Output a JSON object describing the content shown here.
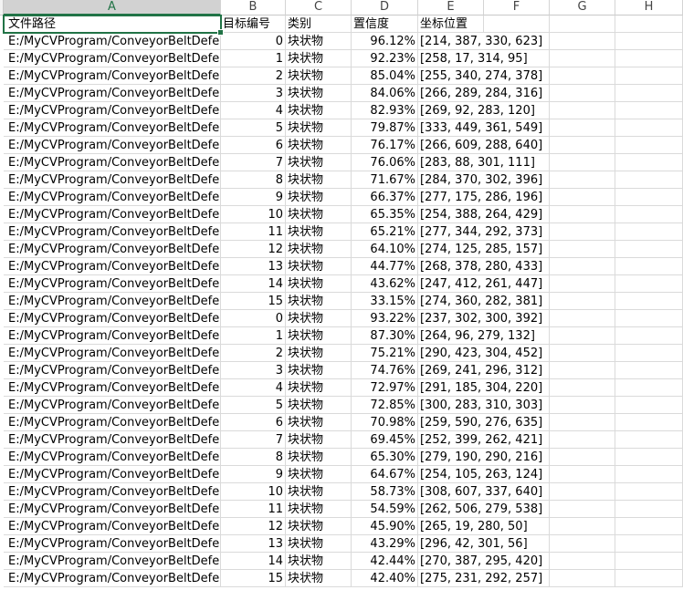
{
  "columns": [
    {
      "letter": "A"
    },
    {
      "letter": "B"
    },
    {
      "letter": "C"
    },
    {
      "letter": "D"
    },
    {
      "letter": "E"
    },
    {
      "letter": "F"
    },
    {
      "letter": "G"
    },
    {
      "letter": "H"
    }
  ],
  "header_row": {
    "a": "文件路径",
    "b": "目标编号",
    "c": "类别",
    "d": "置信度",
    "e": "坐标位置"
  },
  "rows": [
    {
      "path": "E:/MyCVProgram/ConveyorBeltDefe",
      "id": "0",
      "category": "块状物",
      "confidence": "96.12%",
      "bbox": "[214, 387, 330, 623]"
    },
    {
      "path": "E:/MyCVProgram/ConveyorBeltDefe",
      "id": "1",
      "category": "块状物",
      "confidence": "92.23%",
      "bbox": "[258, 17, 314, 95]"
    },
    {
      "path": "E:/MyCVProgram/ConveyorBeltDefe",
      "id": "2",
      "category": "块状物",
      "confidence": "85.04%",
      "bbox": "[255, 340, 274, 378]"
    },
    {
      "path": "E:/MyCVProgram/ConveyorBeltDefe",
      "id": "3",
      "category": "块状物",
      "confidence": "84.06%",
      "bbox": "[266, 289, 284, 316]"
    },
    {
      "path": "E:/MyCVProgram/ConveyorBeltDefe",
      "id": "4",
      "category": "块状物",
      "confidence": "82.93%",
      "bbox": "[269, 92, 283, 120]"
    },
    {
      "path": "E:/MyCVProgram/ConveyorBeltDefe",
      "id": "5",
      "category": "块状物",
      "confidence": "79.87%",
      "bbox": "[333, 449, 361, 549]"
    },
    {
      "path": "E:/MyCVProgram/ConveyorBeltDefe",
      "id": "6",
      "category": "块状物",
      "confidence": "76.17%",
      "bbox": "[266, 609, 288, 640]"
    },
    {
      "path": "E:/MyCVProgram/ConveyorBeltDefe",
      "id": "7",
      "category": "块状物",
      "confidence": "76.06%",
      "bbox": "[283, 88, 301, 111]"
    },
    {
      "path": "E:/MyCVProgram/ConveyorBeltDefe",
      "id": "8",
      "category": "块状物",
      "confidence": "71.67%",
      "bbox": "[284, 370, 302, 396]"
    },
    {
      "path": "E:/MyCVProgram/ConveyorBeltDefe",
      "id": "9",
      "category": "块状物",
      "confidence": "66.37%",
      "bbox": "[277, 175, 286, 196]"
    },
    {
      "path": "E:/MyCVProgram/ConveyorBeltDefe",
      "id": "10",
      "category": "块状物",
      "confidence": "65.35%",
      "bbox": "[254, 388, 264, 429]"
    },
    {
      "path": "E:/MyCVProgram/ConveyorBeltDefe",
      "id": "11",
      "category": "块状物",
      "confidence": "65.21%",
      "bbox": "[277, 344, 292, 373]"
    },
    {
      "path": "E:/MyCVProgram/ConveyorBeltDefe",
      "id": "12",
      "category": "块状物",
      "confidence": "64.10%",
      "bbox": "[274, 125, 285, 157]"
    },
    {
      "path": "E:/MyCVProgram/ConveyorBeltDefe",
      "id": "13",
      "category": "块状物",
      "confidence": "44.77%",
      "bbox": "[268, 378, 280, 433]"
    },
    {
      "path": "E:/MyCVProgram/ConveyorBeltDefe",
      "id": "14",
      "category": "块状物",
      "confidence": "43.62%",
      "bbox": "[247, 412, 261, 447]"
    },
    {
      "path": "E:/MyCVProgram/ConveyorBeltDefe",
      "id": "15",
      "category": "块状物",
      "confidence": "33.15%",
      "bbox": "[274, 360, 282, 381]"
    },
    {
      "path": "E:/MyCVProgram/ConveyorBeltDefe",
      "id": "0",
      "category": "块状物",
      "confidence": "93.22%",
      "bbox": "[237, 302, 300, 392]"
    },
    {
      "path": "E:/MyCVProgram/ConveyorBeltDefe",
      "id": "1",
      "category": "块状物",
      "confidence": "87.30%",
      "bbox": "[264, 96, 279, 132]"
    },
    {
      "path": "E:/MyCVProgram/ConveyorBeltDefe",
      "id": "2",
      "category": "块状物",
      "confidence": "75.21%",
      "bbox": "[290, 423, 304, 452]"
    },
    {
      "path": "E:/MyCVProgram/ConveyorBeltDefe",
      "id": "3",
      "category": "块状物",
      "confidence": "74.76%",
      "bbox": "[269, 241, 296, 312]"
    },
    {
      "path": "E:/MyCVProgram/ConveyorBeltDefe",
      "id": "4",
      "category": "块状物",
      "confidence": "72.97%",
      "bbox": "[291, 185, 304, 220]"
    },
    {
      "path": "E:/MyCVProgram/ConveyorBeltDefe",
      "id": "5",
      "category": "块状物",
      "confidence": "72.85%",
      "bbox": "[300, 283, 310, 303]"
    },
    {
      "path": "E:/MyCVProgram/ConveyorBeltDefe",
      "id": "6",
      "category": "块状物",
      "confidence": "70.98%",
      "bbox": "[259, 590, 276, 635]"
    },
    {
      "path": "E:/MyCVProgram/ConveyorBeltDefe",
      "id": "7",
      "category": "块状物",
      "confidence": "69.45%",
      "bbox": "[252, 399, 262, 421]"
    },
    {
      "path": "E:/MyCVProgram/ConveyorBeltDefe",
      "id": "8",
      "category": "块状物",
      "confidence": "65.30%",
      "bbox": "[279, 190, 290, 216]"
    },
    {
      "path": "E:/MyCVProgram/ConveyorBeltDefe",
      "id": "9",
      "category": "块状物",
      "confidence": "64.67%",
      "bbox": "[254, 105, 263, 124]"
    },
    {
      "path": "E:/MyCVProgram/ConveyorBeltDefe",
      "id": "10",
      "category": "块状物",
      "confidence": "58.73%",
      "bbox": "[308, 607, 337, 640]"
    },
    {
      "path": "E:/MyCVProgram/ConveyorBeltDefe",
      "id": "11",
      "category": "块状物",
      "confidence": "54.59%",
      "bbox": "[262, 506, 279, 538]"
    },
    {
      "path": "E:/MyCVProgram/ConveyorBeltDefe",
      "id": "12",
      "category": "块状物",
      "confidence": "45.90%",
      "bbox": "[265, 19, 280, 50]"
    },
    {
      "path": "E:/MyCVProgram/ConveyorBeltDefe",
      "id": "13",
      "category": "块状物",
      "confidence": "43.29%",
      "bbox": "[296, 42, 301, 56]"
    },
    {
      "path": "E:/MyCVProgram/ConveyorBeltDefe",
      "id": "14",
      "category": "块状物",
      "confidence": "42.44%",
      "bbox": "[270, 387, 295, 420]"
    },
    {
      "path": "E:/MyCVProgram/ConveyorBeltDefe",
      "id": "15",
      "category": "块状物",
      "confidence": "42.40%",
      "bbox": "[275, 231, 292, 257]"
    }
  ],
  "theme": {
    "accent": "#217346",
    "grid": "#dadada",
    "header_selected_bg": "#d2d2d2"
  }
}
